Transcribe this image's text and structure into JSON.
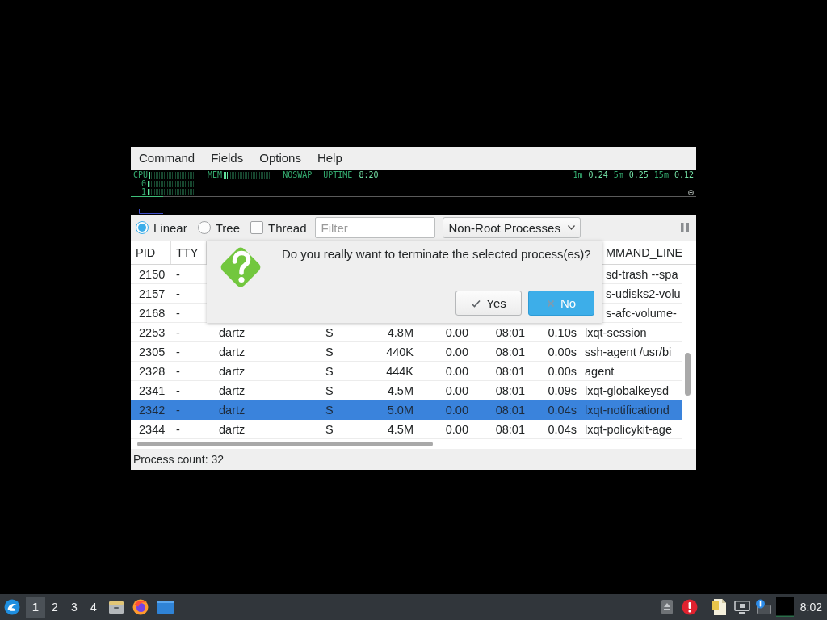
{
  "menu_bar": {
    "items": [
      "Command",
      "Fields",
      "Options",
      "Help"
    ]
  },
  "monitor": {
    "cpu": {
      "label": "CPU",
      "level": 0.03,
      "cores": [
        {
          "label": "0",
          "level": 0.02
        },
        {
          "label": "1",
          "level": 0.02
        }
      ]
    },
    "memory": {
      "label": "MEM",
      "level": 0.13
    },
    "swap": {
      "label": "NOSWAP"
    },
    "uptime": {
      "label": "UPTIME",
      "value": "8:20"
    },
    "load": [
      {
        "label": "1m",
        "value": "0.24"
      },
      {
        "label": "5m",
        "value": "0.25"
      },
      {
        "label": "15m",
        "value": "0.12"
      }
    ]
  },
  "toolbar": {
    "view_modes": [
      {
        "label": "Linear",
        "selected": true
      },
      {
        "label": "Tree",
        "selected": false
      }
    ],
    "thread": {
      "label": "Thread",
      "checked": false
    },
    "filter": {
      "placeholder": "Filter"
    },
    "process_scope": {
      "value": "Non-Root Processes"
    }
  },
  "table": {
    "headers": {
      "column_1": "PID",
      "column_2": "TTY",
      "column_9": "MMAND_LINE"
    },
    "rows": [
      {
        "selected": false,
        "cells": {
          "column_1": "2150",
          "column_2": "-",
          "column_9": "sd-trash --spa"
        }
      },
      {
        "selected": false,
        "cells": {
          "column_1": "2157",
          "column_2": "-",
          "column_9": "s-udisks2-volu"
        }
      },
      {
        "selected": false,
        "cells": {
          "column_1": "2168",
          "column_2": "-",
          "column_9": "s-afc-volume-"
        }
      },
      {
        "selected": false,
        "cells": {
          "column_1": "2253",
          "column_2": "-",
          "column_3": "dartz",
          "column_4": "S",
          "column_5": "4.8M",
          "column_6": "0.00",
          "column_7": "08:01",
          "column_8": "0.10s",
          "column_9": "lxqt-session"
        }
      },
      {
        "selected": false,
        "cells": {
          "column_1": "2305",
          "column_2": "-",
          "column_3": "dartz",
          "column_4": "S",
          "column_5": "440K",
          "column_6": "0.00",
          "column_7": "08:01",
          "column_8": "0.00s",
          "column_9": "ssh-agent /usr/bi"
        }
      },
      {
        "selected": false,
        "cells": {
          "column_1": "2328",
          "column_2": "-",
          "column_3": "dartz",
          "column_4": "S",
          "column_5": "444K",
          "column_6": "0.00",
          "column_7": "08:01",
          "column_8": "0.00s",
          "column_9": "agent"
        }
      },
      {
        "selected": false,
        "cells": {
          "column_1": "2341",
          "column_2": "-",
          "column_3": "dartz",
          "column_4": "S",
          "column_5": "4.5M",
          "column_6": "0.00",
          "column_7": "08:01",
          "column_8": "0.09s",
          "column_9": "lxqt-globalkeysd"
        }
      },
      {
        "selected": true,
        "cells": {
          "column_1": "2342",
          "column_2": "-",
          "column_3": "dartz",
          "column_4": "S",
          "column_5": "5.0M",
          "column_6": "0.00",
          "column_7": "08:01",
          "column_8": "0.04s",
          "column_9": "lxqt-notificationd"
        }
      },
      {
        "selected": false,
        "cells": {
          "column_1": "2344",
          "column_2": "-",
          "column_3": "dartz",
          "column_4": "S",
          "column_5": "4.5M",
          "column_6": "0.00",
          "column_7": "08:01",
          "column_8": "0.04s",
          "column_9": "lxqt-policykit-age"
        }
      }
    ]
  },
  "status_bar": {
    "text": "Process count: 32"
  },
  "dialog": {
    "message": "Do you really want to terminate the selected process(es)?",
    "buttons": [
      {
        "label": "Yes",
        "kind": "confirm",
        "default": false
      },
      {
        "label": "No",
        "kind": "cancel",
        "default": true
      }
    ]
  },
  "taskbar": {
    "workspaces": [
      {
        "label": "1",
        "selected": true
      },
      {
        "label": "2",
        "selected": false
      },
      {
        "label": "3",
        "selected": false
      },
      {
        "label": "4",
        "selected": false
      }
    ],
    "clock": "8:02"
  }
}
